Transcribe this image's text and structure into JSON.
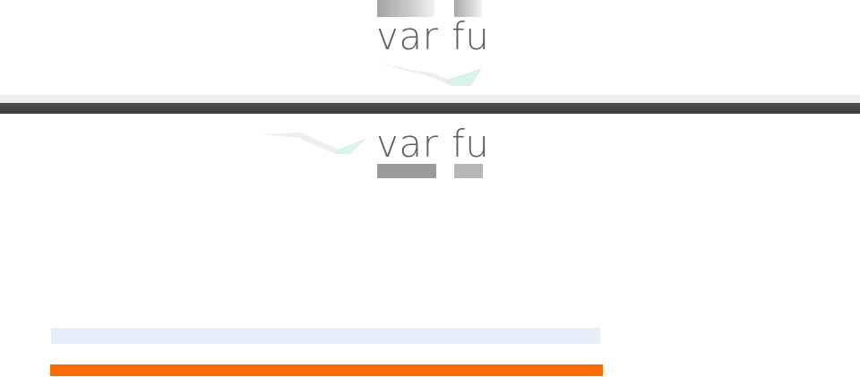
{
  "logo_top": {
    "word_left": "var",
    "word_right": "fu",
    "swoosh_icon": "swoosh-icon"
  },
  "logo_bottom": {
    "word_left": "var",
    "word_right": "fu",
    "swoosh_icon": "swoosh-icon"
  },
  "colors": {
    "wordmark": "#5e5e5e",
    "band_light": "#ececec",
    "band_dark": "#444444",
    "swoosh_gray": "#eeeeee",
    "swoosh_mint": "#d8f3ec",
    "bar_light_blue": "#e6f0fb",
    "bar_orange": "#ff6a00"
  }
}
